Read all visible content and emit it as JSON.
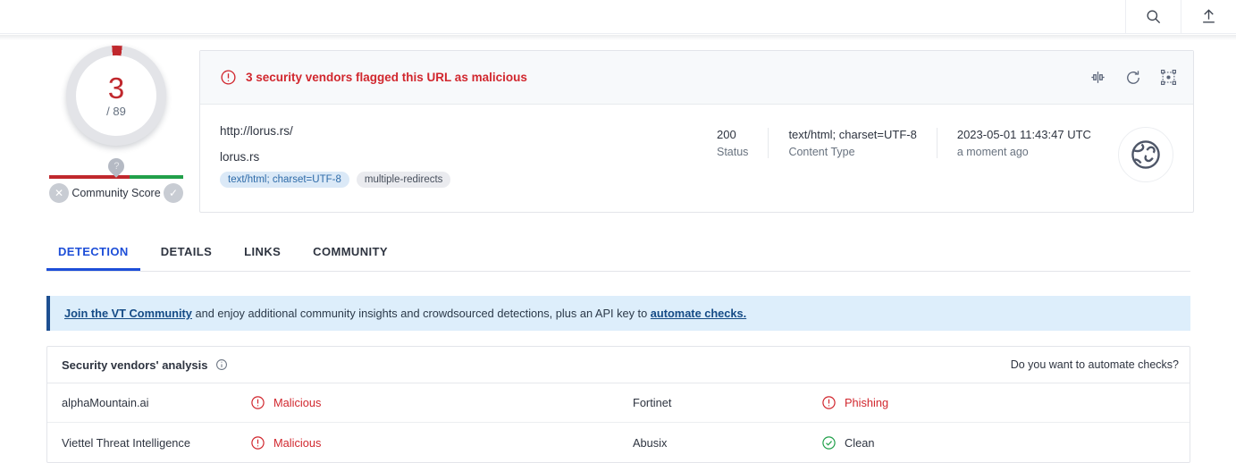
{
  "topbar": {
    "search_icon": "search-icon",
    "upload_icon": "upload-icon"
  },
  "score": {
    "detections": "3",
    "total": "/ 89",
    "community_label": "Community Score",
    "help_marker": "?",
    "negative_icon": "✕",
    "positive_icon": "✓"
  },
  "alert": {
    "icon": "exclamation-circle-icon",
    "text": "3 security vendors flagged this URL as malicious",
    "actions": [
      {
        "name": "compare-icon"
      },
      {
        "name": "reanalyze-icon"
      },
      {
        "name": "graph-icon"
      }
    ]
  },
  "url_card": {
    "url": "http://lorus.rs/",
    "host": "lorus.rs",
    "tags": [
      {
        "label": "text/html; charset=UTF-8",
        "style": "blue"
      },
      {
        "label": "multiple-redirects",
        "style": "grey"
      }
    ],
    "meta": [
      {
        "value": "200",
        "key": "Status"
      },
      {
        "value": "text/html; charset=UTF-8",
        "key": "Content Type"
      }
    ],
    "scan_date": "2023-05-01 11:43:47 UTC",
    "scan_relative": "a moment ago",
    "thumb_icon": "globe-link-icon"
  },
  "tabs": [
    {
      "label": "DETECTION",
      "active": true
    },
    {
      "label": "DETAILS",
      "active": false
    },
    {
      "label": "LINKS",
      "active": false
    },
    {
      "label": "COMMUNITY",
      "active": false
    }
  ],
  "community_banner": {
    "link1": "Join the VT Community",
    "middle": " and enjoy additional community insights and crowdsourced detections, plus an API key to ",
    "link2": "automate checks."
  },
  "vendors_panel": {
    "title": "Security vendors' analysis",
    "info_icon": "info-icon",
    "automate_text": "Do you want to automate checks?",
    "rows": [
      {
        "left": {
          "vendor": "alphaMountain.ai",
          "verdict": "Malicious",
          "status": "malicious"
        },
        "right": {
          "vendor": "Fortinet",
          "verdict": "Phishing",
          "status": "malicious"
        }
      },
      {
        "left": {
          "vendor": "Viettel Threat Intelligence",
          "verdict": "Malicious",
          "status": "malicious"
        },
        "right": {
          "vendor": "Abusix",
          "verdict": "Clean",
          "status": "clean"
        }
      }
    ]
  },
  "colors": {
    "malicious": "#d1272e",
    "clean": "#21a04a",
    "accent": "#1d4ed8",
    "banner_bg": "#ddeefb"
  }
}
